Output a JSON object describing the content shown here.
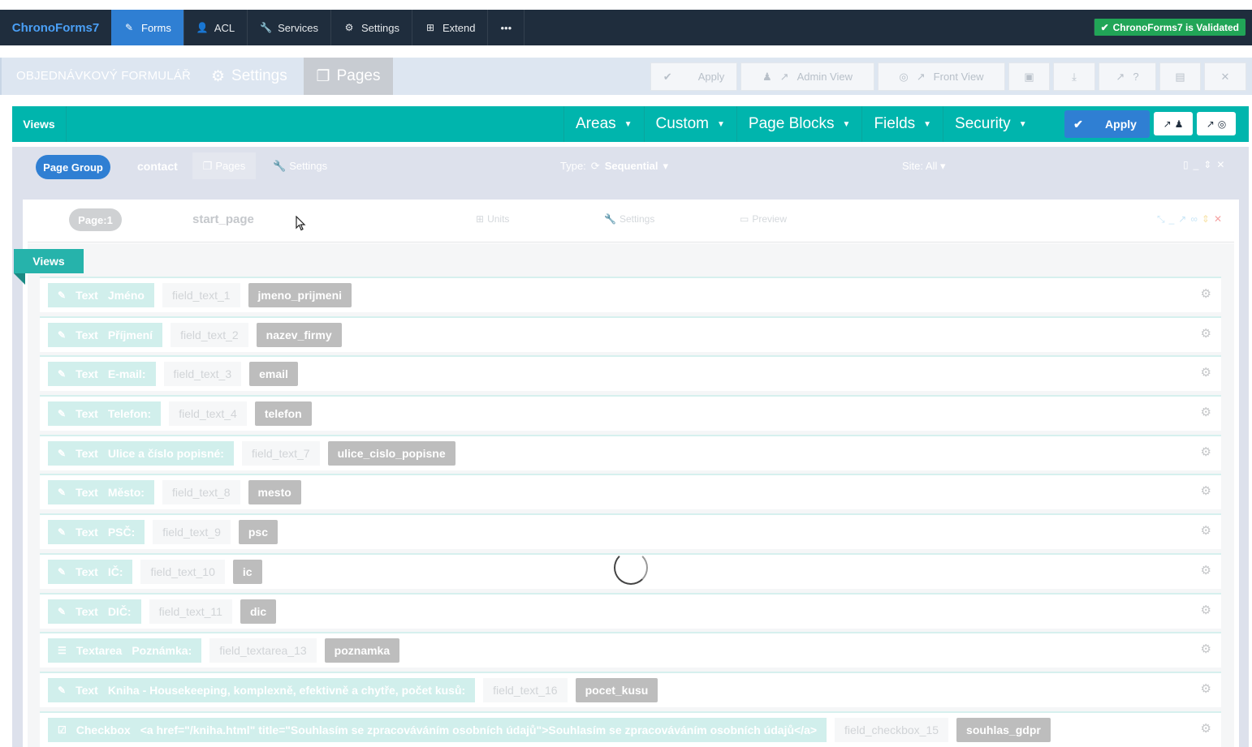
{
  "app": {
    "brand": "ChronoForms7",
    "validated": "ChronoForms7 is Validated"
  },
  "topnav": {
    "items": [
      {
        "label": "Forms",
        "icon": "edit-icon"
      },
      {
        "label": "ACL",
        "icon": "user-icon"
      },
      {
        "label": "Services",
        "icon": "wrench-icon"
      },
      {
        "label": "Settings",
        "icon": "gear-icon"
      },
      {
        "label": "Extend",
        "icon": "sitemap-icon"
      }
    ],
    "more": "•••"
  },
  "formbar": {
    "title": "OBJEDNÁVKOVÝ FORMULÁŘ",
    "tab_settings": "Settings",
    "tab_pages": "Pages",
    "apply": "Apply",
    "admin_view": "Admin View",
    "front_view": "Front View",
    "help": "?"
  },
  "tealbar": {
    "views": "Views",
    "menu": [
      "Areas",
      "Custom",
      "Page Blocks",
      "Fields",
      "Security"
    ],
    "apply": "Apply"
  },
  "page_group": {
    "label": "Page Group",
    "name": "contact",
    "pages": "Pages",
    "settings": "Settings",
    "type_label": "Type:",
    "type_value": "Sequential",
    "site": "Site: All"
  },
  "page": {
    "label": "Page:1",
    "name": "start_page",
    "units": "Units",
    "settings": "Settings",
    "preview": "Preview"
  },
  "views_ribbon": "Views",
  "fields": [
    {
      "type": "Text",
      "label": "Jméno",
      "name": "field_text_1",
      "bind": "jmeno_prijmeni",
      "icon": "edit-icon"
    },
    {
      "type": "Text",
      "label": "Příjmení",
      "name": "field_text_2",
      "bind": "nazev_firmy",
      "icon": "edit-icon"
    },
    {
      "type": "Text",
      "label": "E-mail:",
      "name": "field_text_3",
      "bind": "email",
      "icon": "edit-icon"
    },
    {
      "type": "Text",
      "label": "Telefon:",
      "name": "field_text_4",
      "bind": "telefon",
      "icon": "edit-icon"
    },
    {
      "type": "Text",
      "label": "Ulice a číslo popisné:",
      "name": "field_text_7",
      "bind": "ulice_cislo_popisne",
      "icon": "edit-icon"
    },
    {
      "type": "Text",
      "label": "Město:",
      "name": "field_text_8",
      "bind": "mesto",
      "icon": "edit-icon"
    },
    {
      "type": "Text",
      "label": "PSČ:",
      "name": "field_text_9",
      "bind": "psc",
      "icon": "edit-icon"
    },
    {
      "type": "Text",
      "label": "IČ:",
      "name": "field_text_10",
      "bind": "ic",
      "icon": "edit-icon"
    },
    {
      "type": "Text",
      "label": "DIČ:",
      "name": "field_text_11",
      "bind": "dic",
      "icon": "edit-icon"
    },
    {
      "type": "Textarea",
      "label": "Poznámka:",
      "name": "field_textarea_13",
      "bind": "poznamka",
      "icon": "align-justify-icon"
    },
    {
      "type": "Text",
      "label": "Kniha - Housekeeping, komplexně, efektivně a chytře, počet kusů:",
      "name": "field_text_16",
      "bind": "pocet_kusu",
      "icon": "edit-icon"
    },
    {
      "type": "Checkbox",
      "label": "<a href=\"/kniha.html\" title=\"Souhlasím se zpracováváním osobních údajů\">Souhlasím se zpracováváním osobních údajů</a>",
      "name": "field_checkbox_15",
      "bind": "souhlas_gdpr",
      "icon": "check-square-icon"
    }
  ]
}
